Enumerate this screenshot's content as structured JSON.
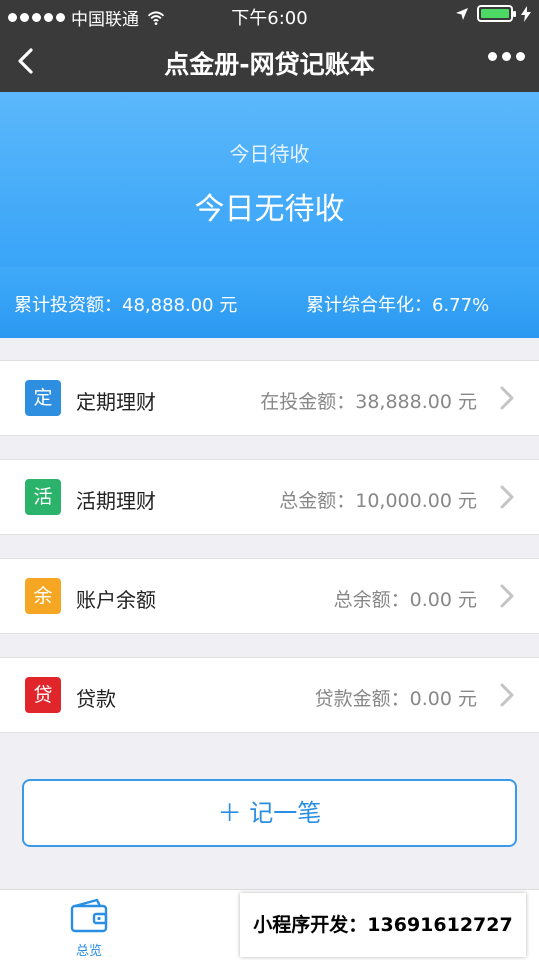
{
  "status": {
    "carrier": "中国联通",
    "time": "下午6:00"
  },
  "nav": {
    "title": "点金册-网贷记账本"
  },
  "summary": {
    "label": "今日待收",
    "value": "今日无待收",
    "total_invest": "累计投资额：48,888.00 元",
    "annual_rate": "累计综合年化：6.77%"
  },
  "accounts": [
    {
      "badge": "定",
      "title": "定期理财",
      "amount": "在投金额：38,888.00 元",
      "color": "#2e8fe0"
    },
    {
      "badge": "活",
      "title": "活期理财",
      "amount": "总金额：10,000.00 元",
      "color": "#2cb36b"
    },
    {
      "badge": "余",
      "title": "账户余额",
      "amount": "总余额：0.00 元",
      "color": "#f5a623"
    },
    {
      "badge": "贷",
      "title": "贷款",
      "amount": "贷款金额：0.00 元",
      "color": "#e0262b"
    }
  ],
  "add_button": "＋ 记一笔",
  "tabbar": {
    "home_label": "总览"
  },
  "promo": "小程序开发：13691612727"
}
